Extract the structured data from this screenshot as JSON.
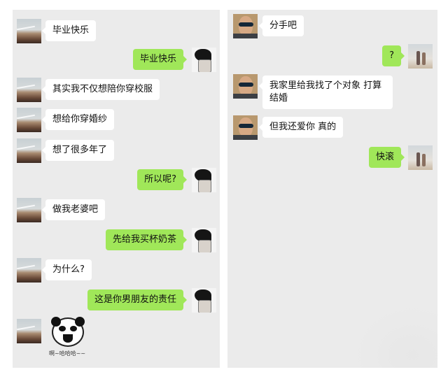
{
  "left_chat": {
    "messages": [
      {
        "side": "in",
        "text": "毕业快乐"
      },
      {
        "side": "out",
        "text": "毕业快乐"
      },
      {
        "side": "in",
        "text": "其实我不仅想陪你穿校服"
      },
      {
        "side": "in",
        "text": "想给你穿婚纱"
      },
      {
        "side": "in",
        "text": "想了很多年了"
      },
      {
        "side": "out",
        "text": "所以呢?"
      },
      {
        "side": "in",
        "text": "做我老婆吧"
      },
      {
        "side": "out",
        "text": "先给我买杯奶茶"
      },
      {
        "side": "in",
        "text": "为什么?"
      },
      {
        "side": "out",
        "text": "这是你男朋友的责任"
      }
    ],
    "sticker": {
      "icon": "panda-laughing-sticker-icon",
      "caption": "啊~哈哈哈~~"
    }
  },
  "right_chat": {
    "messages": [
      {
        "side": "in",
        "text": "分手吧"
      },
      {
        "side": "out",
        "text": "?"
      },
      {
        "side": "in",
        "text": "我家里给我找了个对象 打算结婚"
      },
      {
        "side": "in",
        "text": "但我还爱你 真的"
      },
      {
        "side": "out",
        "text": "快滚"
      }
    ]
  },
  "colors": {
    "chat_bg": "#ebebeb",
    "incoming_bubble": "#ffffff",
    "outgoing_bubble": "#a0e759"
  }
}
